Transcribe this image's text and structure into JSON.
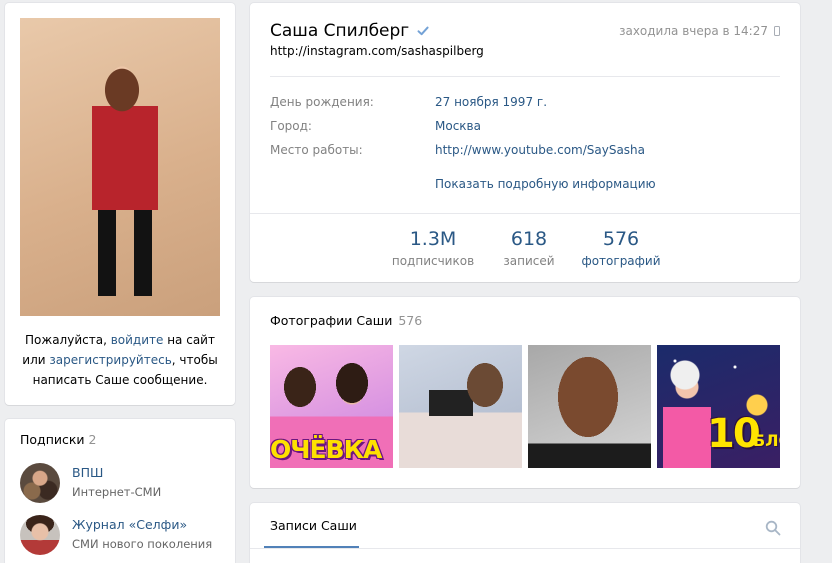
{
  "profile": {
    "name": "Саша Спилберг",
    "status_link": "http://instagram.com/sashaspilberg",
    "online": "заходила вчера в 14:27",
    "info": [
      {
        "label": "День рождения:",
        "value": "27 ноября 1997 г."
      },
      {
        "label": "Город:",
        "value": "Москва"
      },
      {
        "label": "Место работы:",
        "value": "http://www.youtube.com/SaySasha"
      }
    ],
    "show_more": "Показать подробную информацию",
    "stats": [
      {
        "value": "1.3M",
        "label": "подписчиков"
      },
      {
        "value": "618",
        "label": "записей"
      },
      {
        "value": "576",
        "label": "фотографий"
      }
    ]
  },
  "login_prompt": {
    "part1": "Пожалуйста, ",
    "login_link": "войдите",
    "part2": " на сайт или ",
    "register_link": "зарегистрируйтесь",
    "part3": ", чтобы написать Саше сообщение."
  },
  "subscriptions": {
    "title": "Подписки",
    "count": "2",
    "items": [
      {
        "name": "ВПШ",
        "desc": "Интернет-СМИ"
      },
      {
        "name": "Журнал «Селфи»",
        "desc": "СМИ нового поколения"
      }
    ]
  },
  "photos": {
    "title": "Фотографии Саши",
    "count": "576",
    "captions": [
      "ОЧЁВКА",
      "10",
      "БЛО"
    ]
  },
  "wall": {
    "tab": "Записи Саши"
  },
  "colors": {
    "link": "#2a5885",
    "accent": "#5181b8",
    "muted": "#828282",
    "page_bg": "#edeef0"
  },
  "icons": [
    "verified-icon",
    "phone-icon",
    "search-icon"
  ]
}
